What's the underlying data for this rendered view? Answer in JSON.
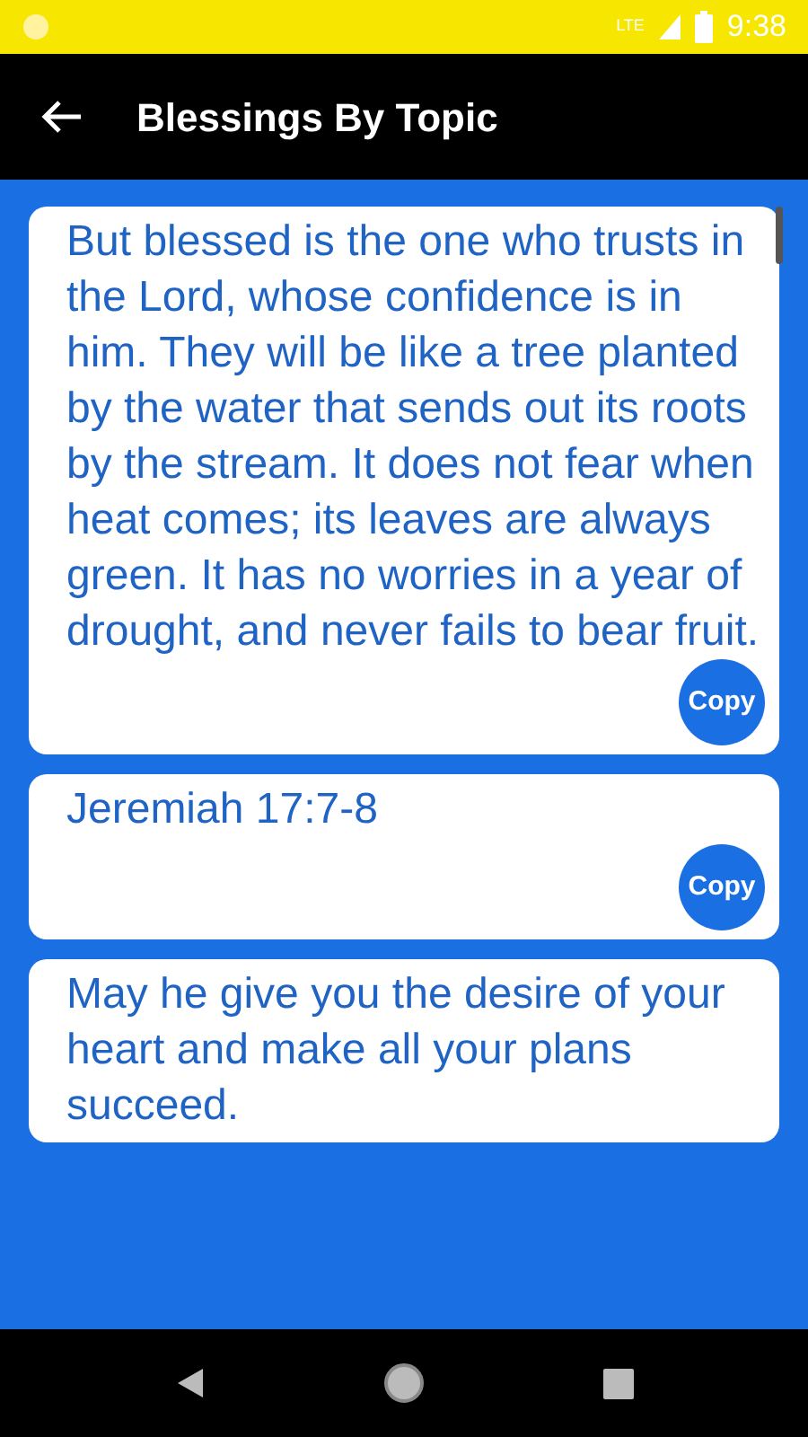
{
  "status_bar": {
    "time": "9:38",
    "network": "LTE"
  },
  "app_bar": {
    "title": "Blessings By Topic"
  },
  "cards": [
    {
      "text": "But blessed is the one who trusts in the Lord, whose confidence is in him. They will be like a tree planted by the water that sends out its roots by the stream. It does not fear when heat comes; its leaves are always green. It has no worries in a year of drought, and never fails to bear fruit.",
      "button": "Copy"
    },
    {
      "text": "Jeremiah 17:7-8",
      "button": "Copy"
    },
    {
      "text": "May he give you the desire of your heart and make all your plans succeed."
    }
  ]
}
